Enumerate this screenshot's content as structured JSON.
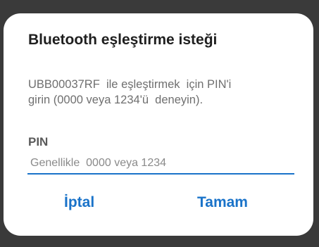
{
  "dialog": {
    "title": "Bluetooth eşleştirme isteği",
    "message": "UBB00037RF  ile eşleştirmek  için PIN'i\ngirin (0000 veya 1234'ü  deneyin).",
    "pin_label": "PIN",
    "pin_placeholder": "Genellikle  0000 veya 1234",
    "pin_value": "",
    "cancel_label": "İptal",
    "ok_label": "Tamam"
  },
  "colors": {
    "accent": "#1a73c9",
    "background": "#3a3a3a",
    "dialog": "#ffffff"
  }
}
